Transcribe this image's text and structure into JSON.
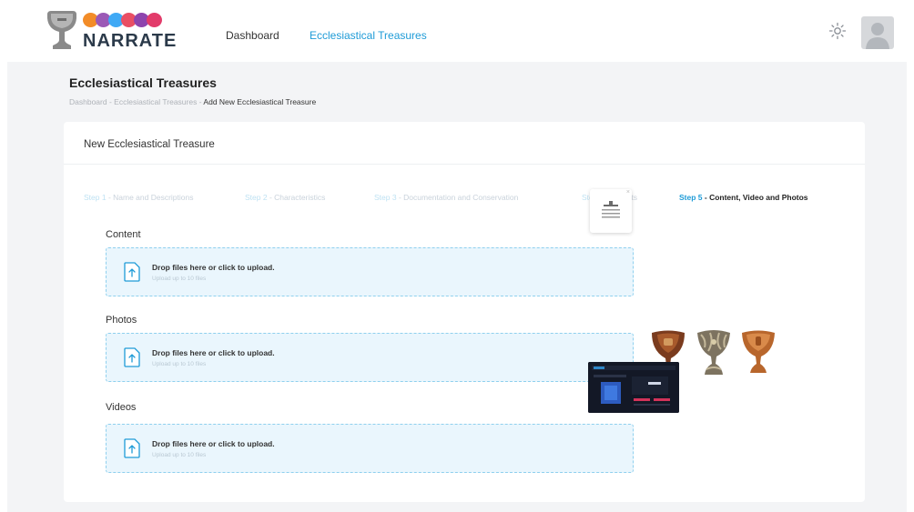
{
  "brand": {
    "name": "NARRATE",
    "dot_colors": [
      "#f28c28",
      "#9b59b6",
      "#3fa9f5",
      "#e94f64",
      "#8e44ad",
      "#e23b6a"
    ]
  },
  "nav": {
    "items": [
      {
        "label": "Dashboard",
        "active": false
      },
      {
        "label": "Ecclesiastical Treasures",
        "active": true
      }
    ]
  },
  "header": {
    "theme_icon": "sun-icon",
    "avatar_icon": "user-avatar-icon"
  },
  "page": {
    "title": "Ecclesiastical Treasures",
    "breadcrumb": {
      "items": [
        "Dashboard",
        "Ecclesiastical Treasures"
      ],
      "separator": " - ",
      "current": "Add New Ecclesiastical Treasure"
    }
  },
  "card": {
    "title": "New Ecclesiastical Treasure"
  },
  "steps": [
    {
      "num": "Step 1",
      "label": " - Name and Descriptions",
      "active": false
    },
    {
      "num": "Step 2",
      "label": " - Characteristics",
      "active": false
    },
    {
      "num": "Step 3",
      "label": " - Documentation and Conservation",
      "active": false
    },
    {
      "num": "Step 4",
      "label": " - Objects",
      "active": false
    },
    {
      "num": "Step 5",
      "label": " - Content, Video and Photos",
      "active": true
    }
  ],
  "sections": {
    "content": {
      "label": "Content",
      "drop_text": "Drop files here or click to upload.",
      "limit_text": "Upload up to 10 files"
    },
    "photos": {
      "label": "Photos",
      "drop_text": "Drop files here or click to upload.",
      "limit_text": "Upload up to 10 files"
    },
    "videos": {
      "label": "Videos",
      "drop_text": "Drop files here or click to upload.",
      "limit_text": "Upload up to 10 files"
    }
  },
  "colors": {
    "accent": "#1e9bd7",
    "dropzone_bg": "#eaf6fd",
    "dropzone_border": "#8fd0ee",
    "page_bg": "#f3f4f6"
  },
  "remove_glyph": "×"
}
